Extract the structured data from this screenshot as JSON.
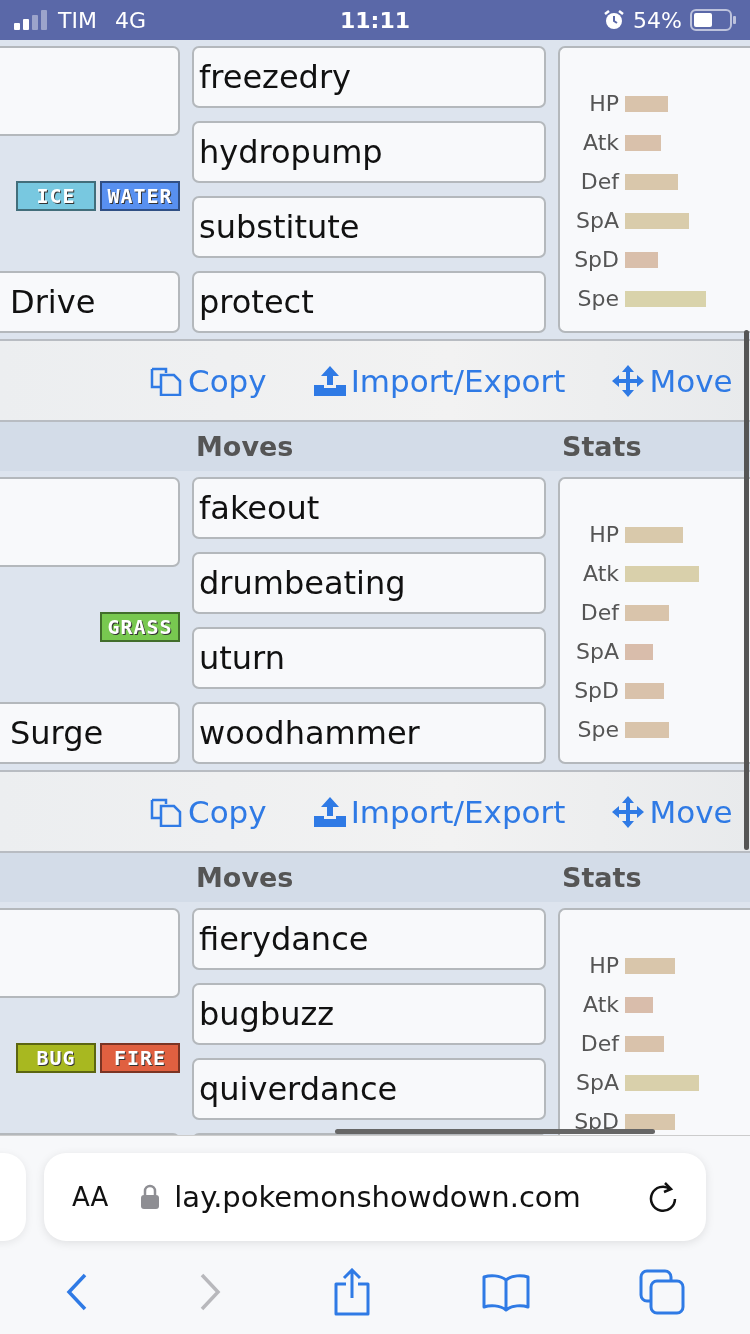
{
  "status_bar": {
    "carrier": "TIM",
    "network": "4G",
    "time": "11:11",
    "battery": "54%"
  },
  "sets": [
    {
      "types": [
        {
          "label": "ICE",
          "color": "#78c8e0"
        },
        {
          "label": "WATER",
          "color": "#5890f0"
        }
      ],
      "ability": "Drive",
      "moves": [
        "freezedry",
        "hydropump",
        "substitute",
        "protect"
      ],
      "stats": [
        {
          "label": "HP"
        },
        {
          "label": "Atk"
        },
        {
          "label": "Def"
        },
        {
          "label": "SpA"
        },
        {
          "label": "SpD"
        },
        {
          "label": "Spe"
        }
      ]
    },
    {
      "toolbar": {
        "copy": "Copy",
        "import_export": "Import/Export",
        "move": "Move"
      },
      "header": {
        "moves": "Moves",
        "stats": "Stats"
      },
      "types": [
        {
          "label": "GRASS",
          "color": "#78c850"
        }
      ],
      "ability": "Surge",
      "moves": [
        "fakeout",
        "drumbeating",
        "uturn",
        "woodhammer"
      ],
      "stats": [
        {
          "label": "HP"
        },
        {
          "label": "Atk"
        },
        {
          "label": "Def"
        },
        {
          "label": "SpA"
        },
        {
          "label": "SpD"
        },
        {
          "label": "Spe"
        }
      ]
    },
    {
      "toolbar": {
        "copy": "Copy",
        "import_export": "Import/Export",
        "move": "Move"
      },
      "header": {
        "moves": "Moves",
        "stats": "Stats"
      },
      "types": [
        {
          "label": "BUG",
          "color": "#a8b820"
        },
        {
          "label": "FIRE",
          "color": "#e06040"
        }
      ],
      "moves": [
        "fierydance",
        "bugbuzz",
        "quiverdance"
      ],
      "stats": [
        {
          "label": "HP"
        },
        {
          "label": "Atk"
        },
        {
          "label": "Def"
        },
        {
          "label": "SpA"
        },
        {
          "label": "SpD"
        }
      ]
    }
  ],
  "browser": {
    "text_size": "AA",
    "url": "lay.pokemonshowdown.com",
    "back_disabled": false,
    "forward_disabled": true
  }
}
